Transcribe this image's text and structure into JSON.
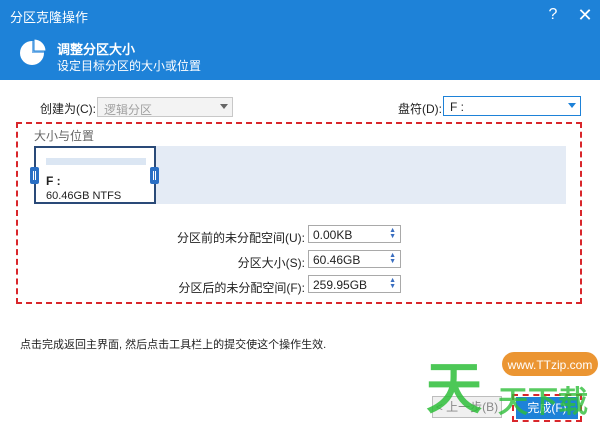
{
  "window": {
    "title": "分区克隆操作",
    "help_label": "?",
    "close_label": "✕"
  },
  "header": {
    "title": "调整分区大小",
    "subtitle": "设定目标分区的大小或位置",
    "icon": "pie-chart-icon"
  },
  "create_as": {
    "label": "创建为(C):",
    "value": "逻辑分区"
  },
  "drive_letter": {
    "label": "盘符(D):",
    "value": "F :"
  },
  "size_position": {
    "group_title": "大小与位置",
    "partition": {
      "name": "F :",
      "info": "60.46GB NTFS"
    },
    "fields": [
      {
        "label": "分区前的未分配空间(U):",
        "value": "0.00KB"
      },
      {
        "label": "分区大小(S):",
        "value": "60.46GB"
      },
      {
        "label": "分区后的未分配空间(F):",
        "value": "259.95GB"
      }
    ]
  },
  "hint": "点击完成返回主界面, 然后点击工具栏上的提交使这个操作生效.",
  "footer": {
    "back_label": "< 上一步(B)",
    "finish_label": "完成(F)"
  },
  "watermark": {
    "url": "www.TTzip.com",
    "brand": "天天下载"
  },
  "colors": {
    "accent": "#1e82d8",
    "highlight": "#d9262b",
    "partition_border": "#2a4a78"
  }
}
